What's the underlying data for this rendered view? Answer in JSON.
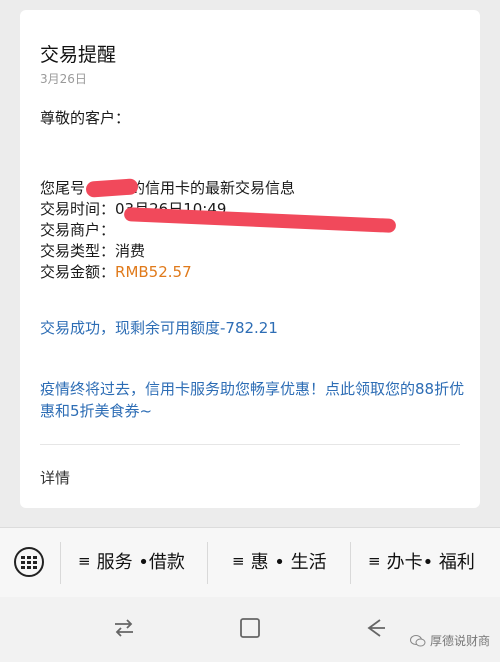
{
  "message": {
    "title": "交易提醒",
    "date": "3月26日",
    "greeting": "尊敬的客户：",
    "line1_prefix": "您尾号",
    "line1_suffix": "的信用卡的最新交易信息",
    "time_label": "交易时间：",
    "time_value": "03月26日10:49",
    "merchant_label": "交易商户：",
    "merchant_tail": "",
    "type_label": "交易类型：",
    "type_value": "消费",
    "amount_label": "交易金额：",
    "amount_value": "RMB52.57",
    "status": "交易成功，现剩余可用额度-782.21",
    "promo": "疫情终将过去，信用卡服务助您畅享优惠！点此领取您的88折优惠和5折美食券~",
    "detail_link": "详情"
  },
  "menu": {
    "items": [
      {
        "label": "服务 •借款"
      },
      {
        "label": "惠 • 生活"
      },
      {
        "label": "办卡• 福利"
      }
    ]
  },
  "watermark": {
    "text": "厚德说财商"
  },
  "colors": {
    "amount": "#e07a1b",
    "link": "#2d6db5",
    "redaction": "#f1495b"
  },
  "icons": [
    "keyboard-icon",
    "recent-apps-icon",
    "home-icon",
    "back-icon",
    "wechat-icon"
  ]
}
